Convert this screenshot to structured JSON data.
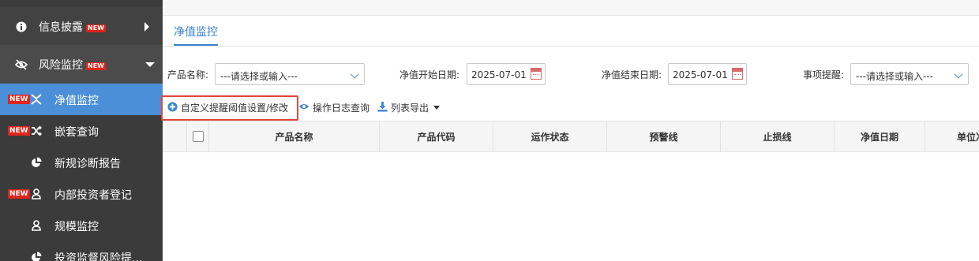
{
  "sidebar": {
    "groups": [
      {
        "label": "信息披露",
        "icon": "info-icon",
        "badge": "NEW",
        "expanded": false
      },
      {
        "label": "风险监控",
        "icon": "eye-slash-icon",
        "badge": "NEW",
        "expanded": true
      }
    ],
    "items": [
      {
        "label": "净值监控",
        "icon": "swap-icon",
        "badge": "NEW",
        "active": true
      },
      {
        "label": "嵌套查询",
        "icon": "shuffle-icon",
        "badge": "NEW",
        "active": false
      },
      {
        "label": "新规诊断报告",
        "icon": "pie-chart-icon",
        "badge": "",
        "active": false
      },
      {
        "label": "内部投资者登记",
        "icon": "user-icon",
        "badge": "NEW",
        "active": false
      },
      {
        "label": "规模监控",
        "icon": "user-icon",
        "badge": "",
        "active": false
      },
      {
        "label": "投资监督风险提...",
        "icon": "pie-chart-icon",
        "badge": "",
        "active": false
      }
    ]
  },
  "tabs": [
    {
      "label": "净值监控",
      "active": true
    }
  ],
  "filters": {
    "product_name": {
      "label": "产品名称:",
      "value": "---请选择或输入---"
    },
    "start_date": {
      "label": "净值开始日期:",
      "value": "2025-07-01"
    },
    "end_date": {
      "label": "净值结束日期:",
      "value": "2025-07-01"
    },
    "reminder": {
      "label": "事项提醒:",
      "value": "---请选择或输入---"
    }
  },
  "toolbar": {
    "custom_threshold": "自定义提醒阈值设置/修改",
    "log_query": "操作日志查询",
    "export": "列表导出"
  },
  "table": {
    "columns": [
      "产品名称",
      "产品代码",
      "运作状态",
      "预警线",
      "止损线",
      "净值日期",
      "单位净"
    ],
    "rows": []
  },
  "colors": {
    "accent": "#3a83cf",
    "sidebar_bg": "#3b3b3b",
    "active_bg": "#4a8fd8",
    "badge": "#e0251b",
    "highlight": "#e0473a"
  }
}
